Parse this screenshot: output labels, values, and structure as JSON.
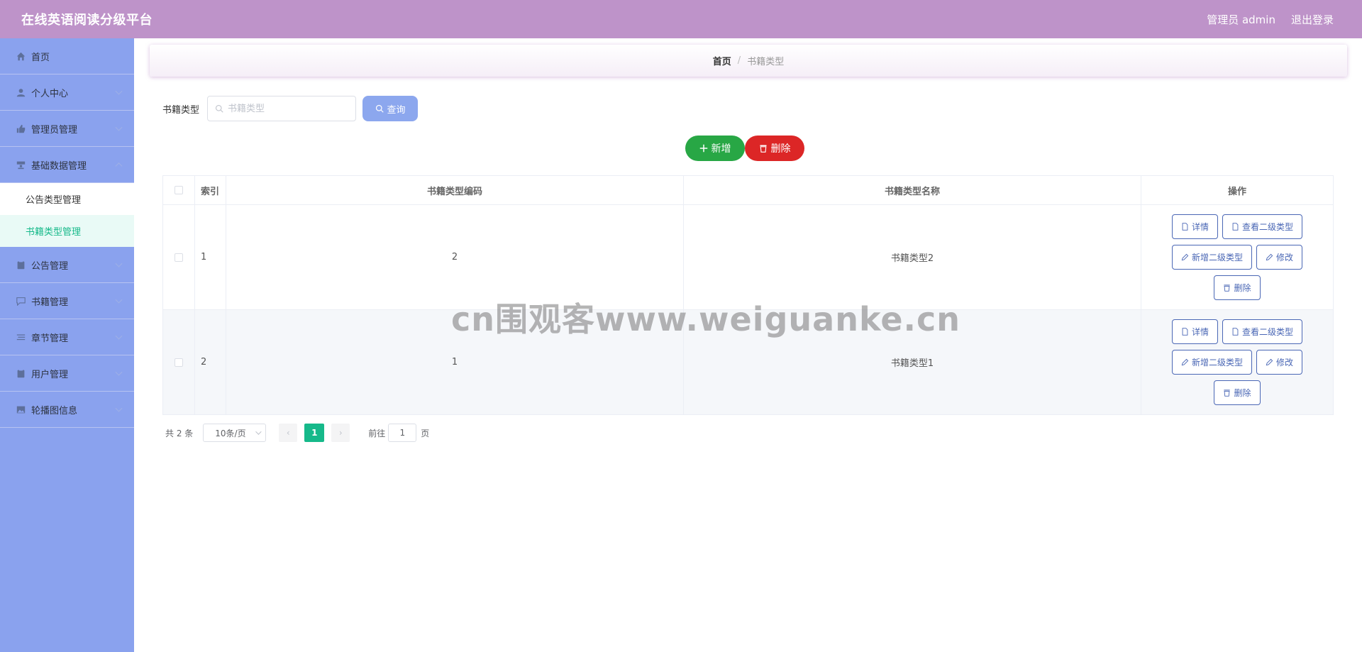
{
  "header": {
    "title": "在线英语阅读分级平台",
    "user": "管理员 admin",
    "logout": "退出登录"
  },
  "sidebar": {
    "items": [
      {
        "label": "首页",
        "icon": "home-icon"
      },
      {
        "label": "个人中心",
        "icon": "user-icon"
      },
      {
        "label": "管理员管理",
        "icon": "thumb-icon"
      },
      {
        "label": "基础数据管理",
        "icon": "server-icon"
      },
      {
        "label": "公告管理",
        "icon": "clipboard-icon"
      },
      {
        "label": "书籍管理",
        "icon": "comment-icon"
      },
      {
        "label": "章节管理",
        "icon": "list-icon"
      },
      {
        "label": "用户管理",
        "icon": "clipboard-icon"
      },
      {
        "label": "轮播图信息",
        "icon": "image-icon"
      }
    ],
    "submenu": [
      {
        "label": "公告类型管理"
      },
      {
        "label": "书籍类型管理"
      }
    ]
  },
  "breadcrumb": {
    "home": "首页",
    "separator": "/",
    "current": "书籍类型"
  },
  "search": {
    "label": "书籍类型",
    "placeholder": "书籍类型",
    "button": "查询"
  },
  "actions": {
    "add": "新增",
    "delete": "删除"
  },
  "table": {
    "headers": {
      "index": "索引",
      "code": "书籍类型编码",
      "name": "书籍类型名称",
      "ops": "操作"
    },
    "rows": [
      {
        "index": "1",
        "code": "2",
        "name": "书籍类型2"
      },
      {
        "index": "2",
        "code": "1",
        "name": "书籍类型1"
      }
    ],
    "op_labels": {
      "detail": "详情",
      "view_sub": "查看二级类型",
      "add_sub": "新增二级类型",
      "edit": "修改",
      "delete": "删除"
    }
  },
  "pagination": {
    "total": "共 2 条",
    "page_size": "10条/页",
    "prev": "‹",
    "current_page": "1",
    "next": "›",
    "goto_label": "前往",
    "goto_value": "1",
    "page_suffix": "页"
  },
  "watermark": "cn围观客www.weiguanke.cn",
  "colors": {
    "header": "#be93c9",
    "sidebar": "#8aa2ee",
    "accent": "#16b98a",
    "add": "#28a745",
    "delete": "#dc2626",
    "op_border": "#4a67b5"
  }
}
